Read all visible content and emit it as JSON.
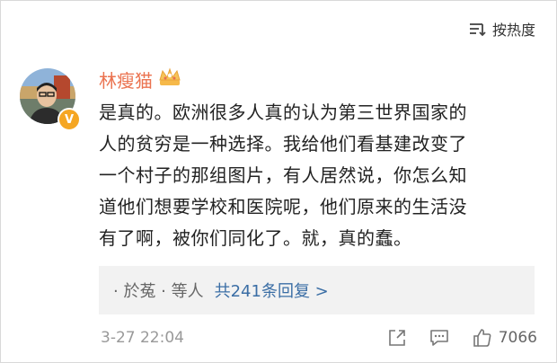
{
  "sort": {
    "label": "按热度"
  },
  "comment": {
    "username": "林瘦猫",
    "avatar_badge": "V",
    "text_lines": [
      "是真的。欧洲很多人真的认为第三世界国家的",
      "人的贫穷是一种选择。我给他们看基建改变了",
      "一个村子的那组图片，有人居然说，你怎么知",
      "道他们想要学校和医院呢，他们原来的生活没",
      "有了啊，被你们同化了。就，真的蠢。"
    ],
    "replies": {
      "names": "· 於菟 · 等人",
      "count": "共241条回复 >"
    },
    "time": "3-27 22:04",
    "likes": "7066"
  },
  "colors": {
    "username": "#eb7350",
    "reply_link": "#3b6ea5",
    "reply_bg": "#f2f2f2",
    "badge": "#f5a623"
  },
  "icons": [
    "sort-icon",
    "crown-icon",
    "share-icon",
    "comment-icon",
    "like-icon"
  ]
}
